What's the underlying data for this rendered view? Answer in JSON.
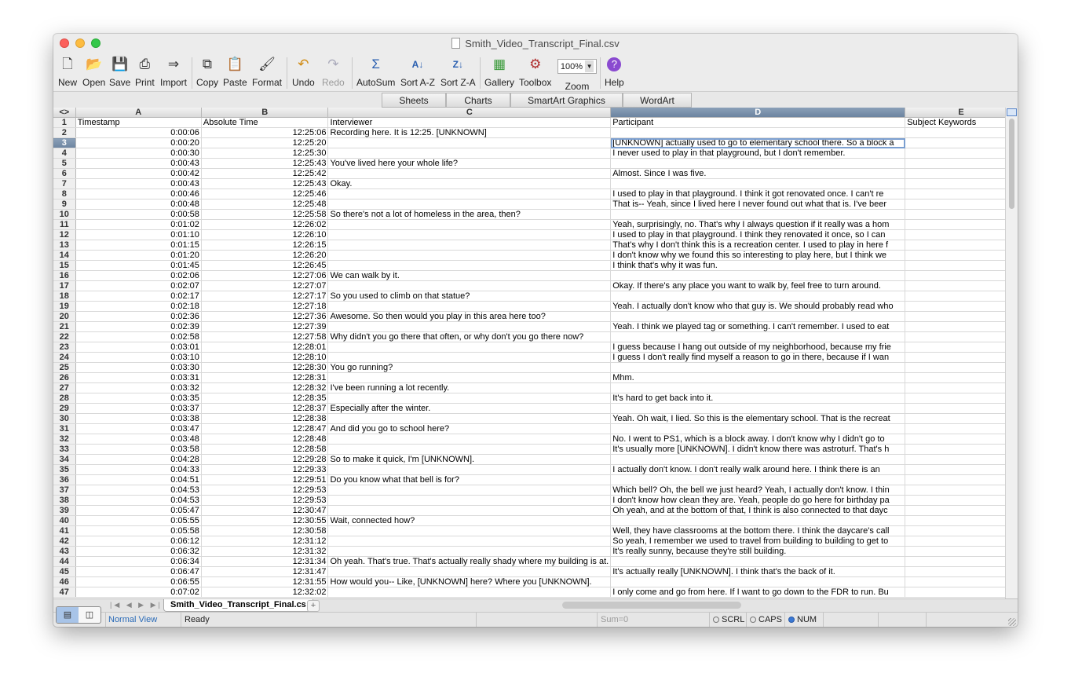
{
  "window": {
    "title": "Smith_Video_Transcript_Final.csv"
  },
  "toolbar": {
    "new": "New",
    "open": "Open",
    "save": "Save",
    "print": "Print",
    "import": "Import",
    "copy": "Copy",
    "paste": "Paste",
    "format": "Format",
    "undo": "Undo",
    "redo": "Redo",
    "autosum": "AutoSum",
    "sort_az": "Sort A-Z",
    "sort_za": "Sort Z-A",
    "gallery": "Gallery",
    "toolbox": "Toolbox",
    "zoom": "Zoom",
    "zoom_value": "100%",
    "help": "Help"
  },
  "ribbon": {
    "tabs": [
      "Sheets",
      "Charts",
      "SmartArt Graphics",
      "WordArt"
    ]
  },
  "grid": {
    "columns": [
      "A",
      "B",
      "C",
      "D",
      "E"
    ],
    "selected_column": "D",
    "active_row": 3,
    "rows": [
      {
        "n": "1",
        "a": "Timestamp",
        "b": "Absolute Time",
        "c": "Interviewer",
        "d": "Participant",
        "e": "Subject Keywords"
      },
      {
        "n": "2",
        "a": "0:00:06",
        "b": "12:25:06",
        "c": "Recording here. It is 12:25. [UNKNOWN]",
        "d": "",
        "e": ""
      },
      {
        "n": "3",
        "a": "0:00:20",
        "b": "12:25:20",
        "c": "",
        "d": "[UNKNOWN] actually used to go to elementary school there. So a block a",
        "e": ""
      },
      {
        "n": "4",
        "a": "0:00:30",
        "b": "12:25:30",
        "c": "",
        "d": "I never used to play in that playground, but I don't remember.",
        "e": ""
      },
      {
        "n": "5",
        "a": "0:00:43",
        "b": "12:25:43",
        "c": "You've lived here your whole life?",
        "d": "",
        "e": ""
      },
      {
        "n": "6",
        "a": "0:00:42",
        "b": "12:25:42",
        "c": "",
        "d": "Almost. Since I was five.",
        "e": ""
      },
      {
        "n": "7",
        "a": "0:00:43",
        "b": "12:25:43",
        "c": "Okay.",
        "d": "",
        "e": ""
      },
      {
        "n": "8",
        "a": "0:00:46",
        "b": "12:25:46",
        "c": "",
        "d": "I used to play in that playground. I think it got renovated once. I can't re",
        "e": ""
      },
      {
        "n": "9",
        "a": "0:00:48",
        "b": "12:25:48",
        "c": "",
        "d": "That is-- Yeah, since I lived here I never found out what that is. I've beer",
        "e": ""
      },
      {
        "n": "10",
        "a": "0:00:58",
        "b": "12:25:58",
        "c": "So there's not a lot of homeless in the area, then?",
        "d": "",
        "e": ""
      },
      {
        "n": "11",
        "a": "0:01:02",
        "b": "12:26:02",
        "c": "",
        "d": "Yeah, surprisingly, no. That's why I always question if it really was a hom",
        "e": ""
      },
      {
        "n": "12",
        "a": "0:01:10",
        "b": "12:26:10",
        "c": "",
        "d": "I used to play in that playground. I think they renovated it once, so I can",
        "e": ""
      },
      {
        "n": "13",
        "a": "0:01:15",
        "b": "12:26:15",
        "c": "",
        "d": "That's why I don't think this is a recreation center. I used to play in here f",
        "e": ""
      },
      {
        "n": "14",
        "a": "0:01:20",
        "b": "12:26:20",
        "c": "",
        "d": "I don't know why we found this so interesting to play here, but I think we",
        "e": ""
      },
      {
        "n": "15",
        "a": "0:01:45",
        "b": "12:26:45",
        "c": "",
        "d": "I think that's why it was fun.",
        "e": ""
      },
      {
        "n": "16",
        "a": "0:02:06",
        "b": "12:27:06",
        "c": "We can walk by it.",
        "d": "",
        "e": ""
      },
      {
        "n": "17",
        "a": "0:02:07",
        "b": "12:27:07",
        "c": "",
        "d": "Okay. If there's any place you want to walk by, feel free to turn around.",
        "e": ""
      },
      {
        "n": "18",
        "a": "0:02:17",
        "b": "12:27:17",
        "c": "So you used to climb on that statue?",
        "d": "",
        "e": ""
      },
      {
        "n": "19",
        "a": "0:02:18",
        "b": "12:27:18",
        "c": "",
        "d": "Yeah. I actually don't know who that guy is. We should probably read who",
        "e": ""
      },
      {
        "n": "20",
        "a": "0:02:36",
        "b": "12:27:36",
        "c": "Awesome. So then would you play in this area here too?",
        "d": "",
        "e": ""
      },
      {
        "n": "21",
        "a": "0:02:39",
        "b": "12:27:39",
        "c": "",
        "d": "Yeah. I think we played tag or something. I can't remember. I used to eat",
        "e": ""
      },
      {
        "n": "22",
        "a": "0:02:58",
        "b": "12:27:58",
        "c": "Why didn't you go there that often, or why don't you go there now?",
        "d": "",
        "e": ""
      },
      {
        "n": "23",
        "a": "0:03:01",
        "b": "12:28:01",
        "c": "",
        "d": "I guess because I hang out outside of my neighborhood, because my frie",
        "e": ""
      },
      {
        "n": "24",
        "a": "0:03:10",
        "b": "12:28:10",
        "c": "",
        "d": "I guess I don't really find myself a reason to go in there, because if I wan",
        "e": ""
      },
      {
        "n": "25",
        "a": "0:03:30",
        "b": "12:28:30",
        "c": "You go running?",
        "d": "",
        "e": ""
      },
      {
        "n": "26",
        "a": "0:03:31",
        "b": "12:28:31",
        "c": "",
        "d": "Mhm.",
        "e": ""
      },
      {
        "n": "27",
        "a": "0:03:32",
        "b": "12:28:32",
        "c": "I've been running a lot recently.",
        "d": "",
        "e": ""
      },
      {
        "n": "28",
        "a": "0:03:35",
        "b": "12:28:35",
        "c": "",
        "d": "It's hard to get back into it.",
        "e": ""
      },
      {
        "n": "29",
        "a": "0:03:37",
        "b": "12:28:37",
        "c": "Especially after the winter.",
        "d": "",
        "e": ""
      },
      {
        "n": "30",
        "a": "0:03:38",
        "b": "12:28:38",
        "c": "",
        "d": "Yeah. Oh wait, I lied. So this is the elementary school. That is the recreat",
        "e": ""
      },
      {
        "n": "31",
        "a": "0:03:47",
        "b": "12:28:47",
        "c": "And did you go to school here?",
        "d": "",
        "e": ""
      },
      {
        "n": "32",
        "a": "0:03:48",
        "b": "12:28:48",
        "c": "",
        "d": "No. I went to PS1, which is a block away. I don't know why I didn't go to",
        "e": ""
      },
      {
        "n": "33",
        "a": "0:03:58",
        "b": "12:28:58",
        "c": "",
        "d": "It's usually more [UNKNOWN]. I didn't know there was astroturf. That's h",
        "e": ""
      },
      {
        "n": "34",
        "a": "0:04:28",
        "b": "12:29:28",
        "c": "So to make it quick, I'm [UNKNOWN].",
        "d": "",
        "e": ""
      },
      {
        "n": "35",
        "a": "0:04:33",
        "b": "12:29:33",
        "c": "",
        "d": "I actually don't know. I don't really walk around here. I think there is an",
        "e": ""
      },
      {
        "n": "36",
        "a": "0:04:51",
        "b": "12:29:51",
        "c": "Do you know what that bell is for?",
        "d": "",
        "e": ""
      },
      {
        "n": "37",
        "a": "0:04:53",
        "b": "12:29:53",
        "c": "",
        "d": "Which bell? Oh, the bell we just heard? Yeah, I actually don't know. I thin",
        "e": ""
      },
      {
        "n": "38",
        "a": "0:04:53",
        "b": "12:29:53",
        "c": "",
        "d": "I don't know how clean they are. Yeah, people do go here for birthday pa",
        "e": ""
      },
      {
        "n": "39",
        "a": "0:05:47",
        "b": "12:30:47",
        "c": "",
        "d": "Oh yeah, and at the bottom of that, I think is also connected to that dayc",
        "e": ""
      },
      {
        "n": "40",
        "a": "0:05:55",
        "b": "12:30:55",
        "c": "Wait, connected how?",
        "d": "",
        "e": ""
      },
      {
        "n": "41",
        "a": "0:05:58",
        "b": "12:30:58",
        "c": "",
        "d": "Well, they have classrooms at the bottom there. I think the daycare's call",
        "e": ""
      },
      {
        "n": "42",
        "a": "0:06:12",
        "b": "12:31:12",
        "c": "",
        "d": "So yeah, I remember we used to travel from building to building to get to",
        "e": ""
      },
      {
        "n": "43",
        "a": "0:06:32",
        "b": "12:31:32",
        "c": "",
        "d": "It's really sunny, because they're still building.",
        "e": ""
      },
      {
        "n": "44",
        "a": "0:06:34",
        "b": "12:31:34",
        "c": "Oh yeah. That's true. That's actually really shady where my building is at.",
        "d": "",
        "e": ""
      },
      {
        "n": "45",
        "a": "0:06:47",
        "b": "12:31:47",
        "c": "",
        "d": "It's actually really [UNKNOWN]. I think that's the back of it.",
        "e": ""
      },
      {
        "n": "46",
        "a": "0:06:55",
        "b": "12:31:55",
        "c": "How would you-- Like, [UNKNOWN] here? Where you [UNKNOWN].",
        "d": "",
        "e": ""
      },
      {
        "n": "47",
        "a": "0:07:02",
        "b": "12:32:02",
        "c": "",
        "d": "I only come and go from here. If I want to go down to the FDR to run. Bu",
        "e": ""
      }
    ]
  },
  "sheet_tabs": {
    "active": "Smith_Video_Transcript_Final.cs",
    "add": "+"
  },
  "status": {
    "view": "Normal View",
    "state": "Ready",
    "sum": "Sum=0",
    "scrl": "SCRL",
    "caps": "CAPS",
    "num": "NUM"
  },
  "colors": {
    "selected_header": "#7a91ad",
    "active_cell_border": "#7b9fd0",
    "num_lock_on": "#3a78d4"
  }
}
